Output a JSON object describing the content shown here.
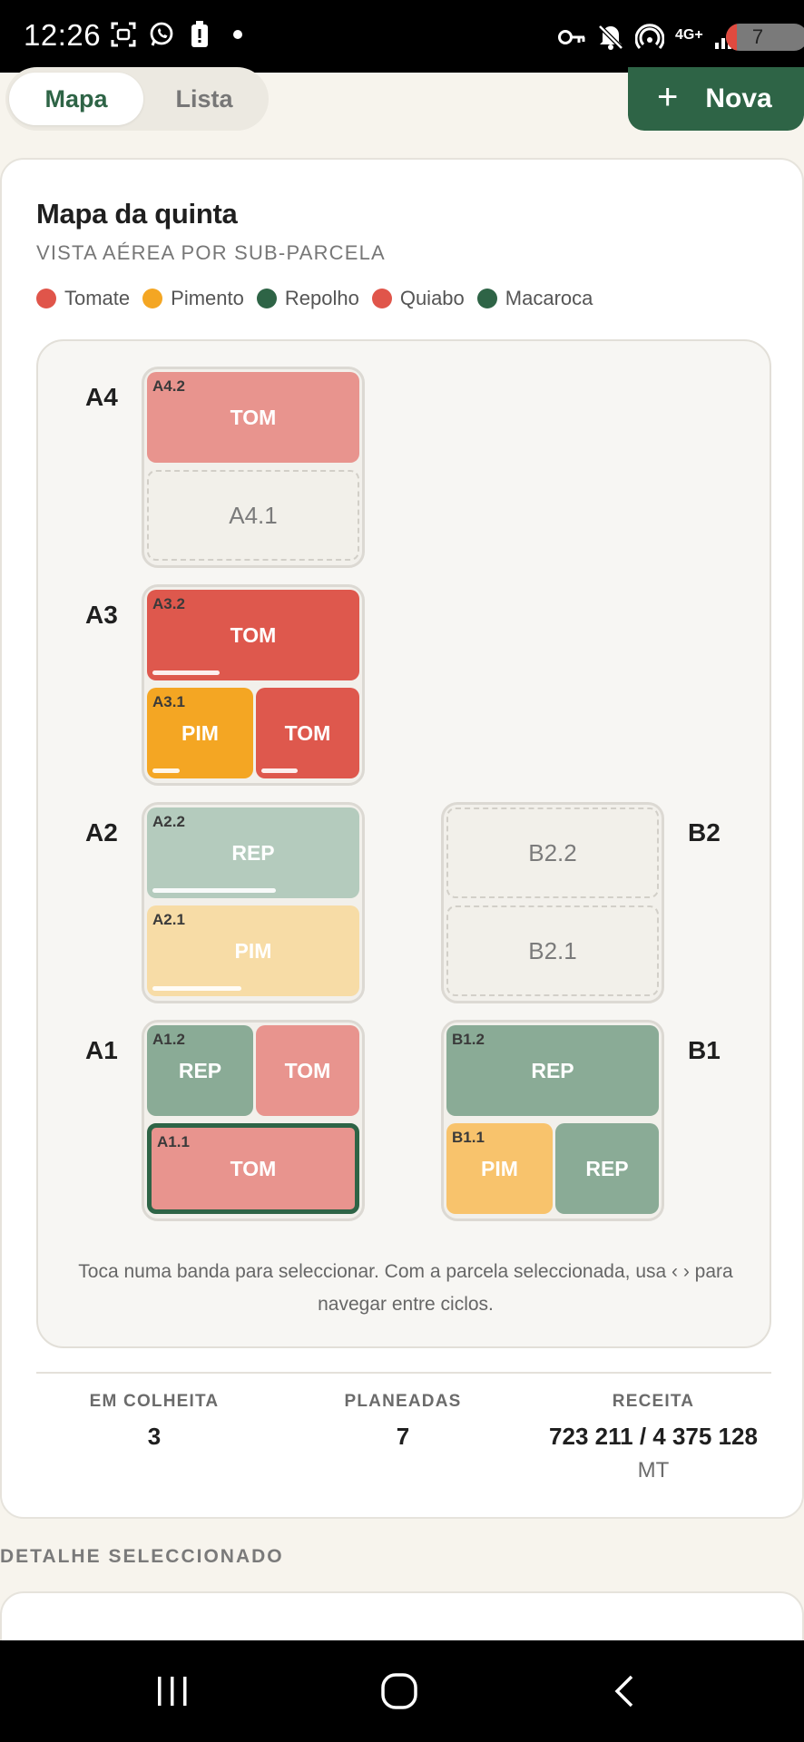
{
  "status_bar": {
    "time": "12:26",
    "network": "4G+",
    "battery": "7",
    "left_icons": [
      "screenshot-icon",
      "whatsapp-icon",
      "battery-alert-icon",
      "dot-icon"
    ],
    "right_icons": [
      "vpn-key-icon",
      "mute-icon",
      "hotspot-icon",
      "signal-icon"
    ]
  },
  "tabs": {
    "map_label": "Mapa",
    "list_label": "Lista"
  },
  "new_button": {
    "label": "Nova",
    "icon": "plus-icon"
  },
  "card": {
    "title": "Mapa da quinta",
    "subtitle": "VISTA AÉREA POR SUB-PARCELA"
  },
  "legend": [
    {
      "label": "Tomate",
      "color": "#e0554a"
    },
    {
      "label": "Pimento",
      "color": "#f4a623"
    },
    {
      "label": "Repolho",
      "color": "#2e6446"
    },
    {
      "label": "Quiabo",
      "color": "#e0554a"
    },
    {
      "label": "Macaroca",
      "color": "#2e6446"
    }
  ],
  "rows": {
    "a4": "A4",
    "a3": "A3",
    "a2": "A2",
    "a1": "A1",
    "b2": "B2",
    "b1": "B1"
  },
  "bands": {
    "a42": {
      "code": "A4.2",
      "crop": "TOM"
    },
    "a41": {
      "label": "A4.1"
    },
    "a32": {
      "code": "A3.2",
      "crop": "TOM",
      "progress": 0.32
    },
    "a31a": {
      "code": "A3.1",
      "crop": "PIM",
      "progress": 0.26
    },
    "a31b": {
      "crop": "TOM",
      "progress": 0.34
    },
    "a22": {
      "code": "A2.2",
      "crop": "REP",
      "progress": 0.6
    },
    "a21": {
      "code": "A2.1",
      "crop": "PIM",
      "progress": 0.42
    },
    "a12a": {
      "code": "A1.2",
      "crop": "REP"
    },
    "a12b": {
      "crop": "TOM"
    },
    "a11": {
      "code": "A1.1",
      "crop": "TOM",
      "selected": true
    },
    "b22": {
      "label": "B2.2"
    },
    "b21": {
      "label": "B2.1"
    },
    "b12": {
      "code": "B1.2",
      "crop": "REP"
    },
    "b11a": {
      "code": "B1.1",
      "crop": "PIM"
    },
    "b11b": {
      "crop": "REP"
    }
  },
  "hint": "Toca numa banda para seleccionar. Com a parcela seleccionada, usa ‹ › para navegar entre ciclos.",
  "stats": {
    "harvest_label": "EM COLHEITA",
    "harvest_value": "3",
    "planned_label": "PLANEADAS",
    "planned_value": "7",
    "revenue_label": "RECEITA",
    "revenue_value": "723 211 / 4 375 128",
    "revenue_unit": "MT"
  },
  "detail_section": {
    "title": "DETALHE SELECCIONADO"
  },
  "colors": {
    "brand_green": "#2e6446",
    "tomato_light": "#e8948e",
    "tomato_strong": "#de584d",
    "pepper_strong": "#f4a623",
    "pepper_light": "#f7dca6",
    "pepper_mid": "#f8c36c",
    "cabbage_light": "#b4cbbd",
    "cabbage_mid": "#8aab96"
  }
}
